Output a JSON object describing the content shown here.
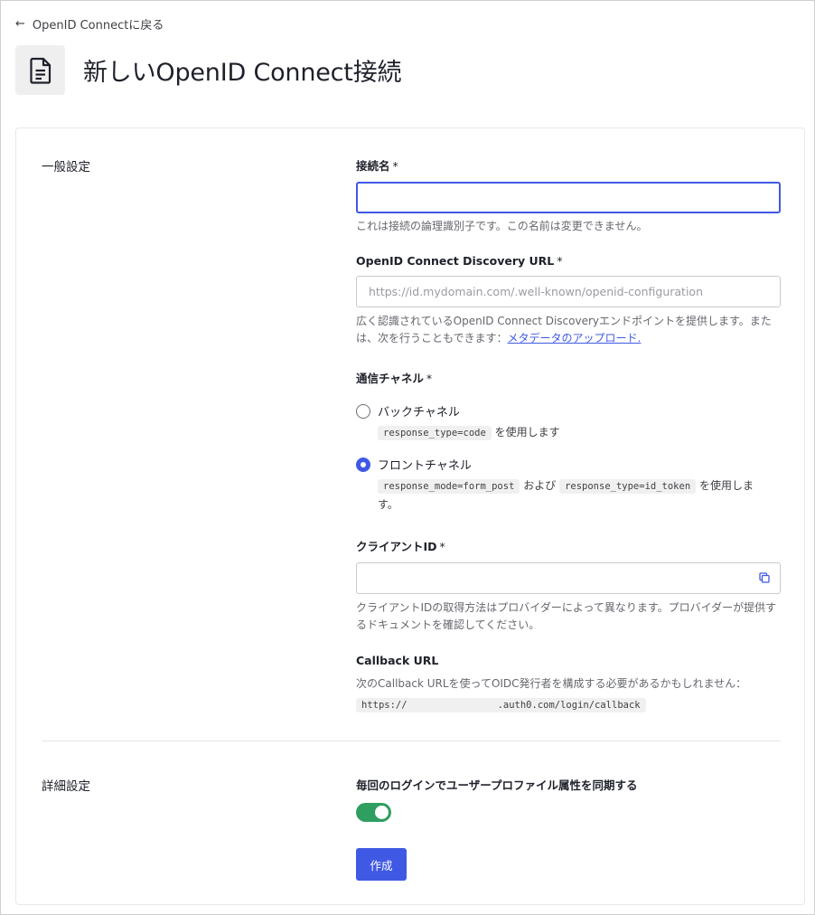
{
  "nav": {
    "back_label": "OpenID Connectに戻る"
  },
  "header": {
    "icon": "document-icon",
    "title": "新しいOpenID Connect接続"
  },
  "general": {
    "section_label": "一般設定",
    "connection_name": {
      "label": "接続名",
      "required_mark": "*",
      "value": "",
      "help": "これは接続の論理識別子です。この名前は変更できません。"
    },
    "discovery_url": {
      "label": "OpenID Connect Discovery URL",
      "required_mark": "*",
      "placeholder": "https://id.mydomain.com/.well-known/openid-configuration",
      "help_prefix": "広く認識されているOpenID Connect Discoveryエンドポイントを提供します。または、次を行うこともできます：",
      "help_link": "メタデータのアップロード."
    },
    "channel": {
      "label": "通信チャネル",
      "required_mark": "*",
      "options": [
        {
          "label": "バックチャネル",
          "checked": false,
          "code1": "response_type=code",
          "text1": "を使用します"
        },
        {
          "label": "フロントチャネル",
          "checked": true,
          "code1": "response_mode=form_post",
          "text1": "および",
          "code2": "response_type=id_token",
          "text2": "を使用します。"
        }
      ]
    },
    "client_id": {
      "label": "クライアントID",
      "required_mark": "*",
      "value": "",
      "icon": "copy-icon",
      "help": "クライアントIDの取得方法はプロバイダーによって異なります。プロバイダーが提供するドキュメントを確認してください。"
    },
    "callback": {
      "label": "Callback URL",
      "help": "次のCallback URLを使ってOIDC発行者を構成する必要があるかもしれません：",
      "url_prefix": "https://",
      "url_suffix": ".auth0.com/login/callback"
    }
  },
  "advanced": {
    "section_label": "詳細設定",
    "sync_label": "毎回のログインでユーザープロファイル属性を同期する",
    "sync_enabled": true
  },
  "actions": {
    "create_label": "作成"
  },
  "colors": {
    "accent": "#3f59e4",
    "toggle_on": "#2e9e61"
  }
}
